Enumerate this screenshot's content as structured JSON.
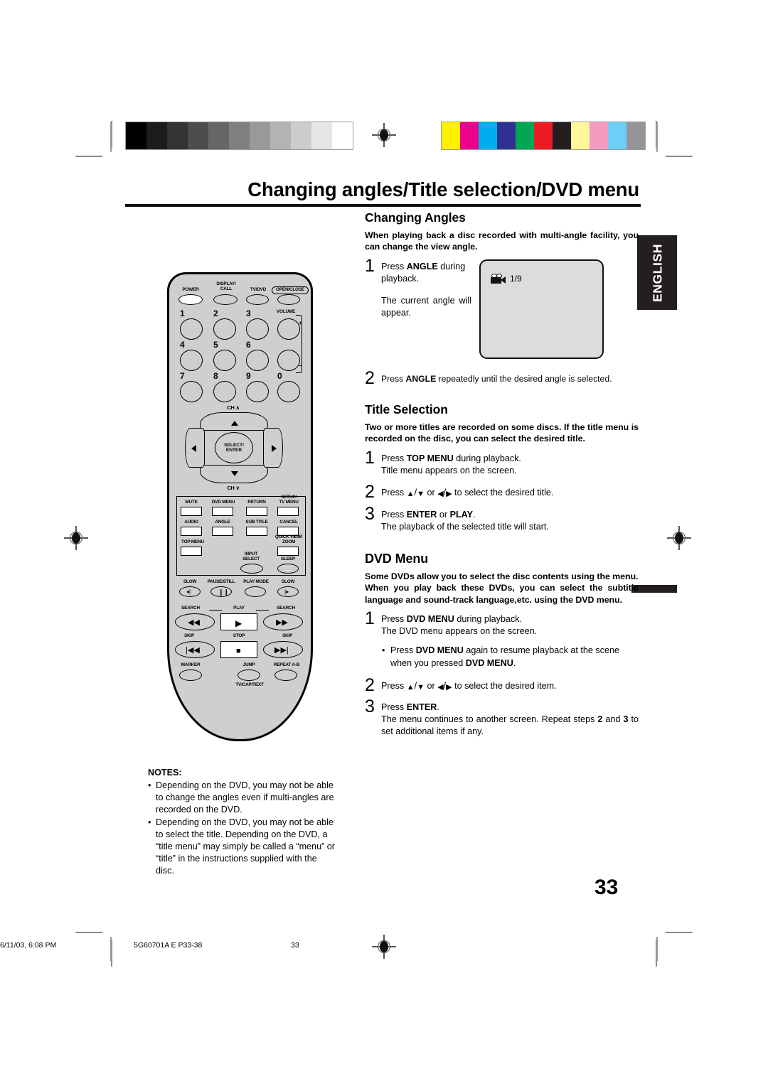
{
  "header": {
    "title": "Changing angles/Title selection/DVD menu",
    "lang_tab": "ENGLISH"
  },
  "sections": {
    "changing_angles": {
      "heading": "Changing Angles",
      "lead": "When playing back a disc recorded with multi-angle facility, you can change the view angle.",
      "step1_num": "1",
      "step1_a_pre": "Press ",
      "step1_a_key": "ANGLE",
      "step1_a_post": " during playback.",
      "step1_b": "The current angle will appear.",
      "osd_value": "1/9",
      "osd_icon": "camera-icon",
      "step2_num": "2",
      "step2_pre": "Press ",
      "step2_key": "ANGLE",
      "step2_post": " repeatedly until the desired angle is selected."
    },
    "title_selection": {
      "heading": "Title Selection",
      "lead": "Two or more titles are recorded on some discs. If the title menu is recorded on the disc, you can select the desired title.",
      "step1_num": "1",
      "step1_pre": "Press ",
      "step1_key": "TOP MENU",
      "step1_post": " during playback.",
      "step1_sub": "Title menu appears on the screen.",
      "step2_num": "2",
      "step2_pre": "Press ",
      "step2_mid": " or ",
      "step2_post": " to select the desired title.",
      "step3_num": "3",
      "step3_pre": "Press ",
      "step3_key1": "ENTER",
      "step3_mid": " or ",
      "step3_key2": "PLAY",
      "step3_post": ".",
      "step3_sub": "The playback of the selected title will start."
    },
    "dvd_menu": {
      "heading": "DVD Menu",
      "lead1": "Some DVDs allow you to select the disc contents using the menu.",
      "lead2": "When you play back these DVDs, you can select the subtitle language and sound-track language,etc. using the DVD menu.",
      "step1_num": "1",
      "step1_pre": "Press ",
      "step1_key": "DVD MENU",
      "step1_post": " during playback.",
      "step1_sub": "The DVD menu appears on the screen.",
      "bullet_dot": "•",
      "bullet_pre": "Press ",
      "bullet_key1": "DVD MENU",
      "bullet_mid": " again to resume playback at the scene when you pressed ",
      "bullet_key2": "DVD MENU",
      "bullet_post": ".",
      "step2_num": "2",
      "step2_pre": "Press ",
      "step2_mid": " or ",
      "step2_post": " to select the desired item.",
      "step3_num": "3",
      "step3_pre": "Press ",
      "step3_key": "ENTER",
      "step3_post": ".",
      "step3_sub_a": "The menu continues to another screen. Repeat steps ",
      "step3_sub_b": "2",
      "step3_sub_c": " and ",
      "step3_sub_d": "3",
      "step3_sub_e": " to set additional items if any."
    }
  },
  "arrows": {
    "up": "▲",
    "down": "▼",
    "left": "◀",
    "right": "▶",
    "slash": "/"
  },
  "notes": {
    "heading": "NOTES:",
    "bullet": "•",
    "items": [
      "Depending on the DVD, you may not be able to change the angles even if multi-angles are recorded on the DVD.",
      "Depending on the DVD, you may not be able to select the title. Depending on the DVD, a “title menu” may simply be called a “menu” or “title” in the instructions supplied with the disc."
    ]
  },
  "page_number": "33",
  "footer": {
    "doc_code": "5G60701A E P33-38",
    "page": "33",
    "timestamp": "6/11/03, 6:08 PM"
  },
  "print_marks": {
    "grayscale": [
      "#000000",
      "#1c1c1c",
      "#333333",
      "#4d4d4d",
      "#666666",
      "#808080",
      "#999999",
      "#b3b3b3",
      "#cccccc",
      "#e6e6e6",
      "#ffffff"
    ],
    "colors": [
      "#fff100",
      "#ec008c",
      "#00aeef",
      "#2e3192",
      "#00a651",
      "#ed1c24",
      "#231f20",
      "#fff79a",
      "#f49ac1",
      "#6dcff6",
      "#939598"
    ]
  },
  "remote": {
    "top_buttons": [
      {
        "label": "POWER",
        "name": "power-button"
      },
      {
        "label": "DISPLAY/\nCALL",
        "name": "display-call-button"
      },
      {
        "label": "TV/DVD",
        "name": "tv-dvd-button"
      },
      {
        "label": "OPEN/CLOSE",
        "name": "open-close-button"
      }
    ],
    "keypad": [
      "1",
      "2",
      "3",
      "4",
      "5",
      "6",
      "7",
      "8",
      "9",
      "0"
    ],
    "volume_label": "VOLUME",
    "volume_plus": "+",
    "volume_minus": "–",
    "dpad": {
      "ch_up": "CH",
      "ch_up_arrow": "∧",
      "ch_down": "CH",
      "ch_down_arrow": "∨",
      "center_line1": "SELECT/",
      "center_line2": "ENTER"
    },
    "function_buttons": [
      {
        "label": "MUTE",
        "name": "mute-button"
      },
      {
        "label": "DVD MENU",
        "name": "dvd-menu-button"
      },
      {
        "label": "RETURN",
        "name": "return-button"
      },
      {
        "label": "SETUP/\nTV MENU",
        "name": "setup-tv-menu-button"
      },
      {
        "label": "AUDIO",
        "name": "audio-button"
      },
      {
        "label": "ANGLE",
        "name": "angle-button"
      },
      {
        "label": "SUB TITLE",
        "name": "sub-title-button"
      },
      {
        "label": "CANCEL",
        "name": "cancel-button"
      },
      {
        "label": "TOP MENU",
        "name": "top-menu-button"
      },
      {
        "label": "QUICK VIEW/\nZOOM",
        "name": "quick-view-zoom-button"
      },
      {
        "label": "INPUT\nSELECT",
        "name": "input-select-button"
      },
      {
        "label": "SLEEP",
        "name": "sleep-button"
      }
    ],
    "transport_row1": [
      {
        "label": "SLOW",
        "name": "slow-reverse-button"
      },
      {
        "label": "PAUSE/STILL",
        "name": "pause-still-button"
      },
      {
        "label": "PLAY MODE",
        "name": "play-mode-button"
      },
      {
        "label": "SLOW",
        "name": "slow-forward-button"
      }
    ],
    "transport_row2": [
      {
        "label": "SEARCH",
        "name": "search-reverse-button"
      },
      {
        "label": "PLAY",
        "name": "play-button"
      },
      {
        "label": "SEARCH",
        "name": "search-forward-button"
      }
    ],
    "transport_row3": [
      {
        "label": "SKIP",
        "name": "skip-back-button"
      },
      {
        "label": "STOP",
        "name": "stop-button"
      },
      {
        "label": "SKIP",
        "name": "skip-forward-button"
      }
    ],
    "transport_row4": [
      {
        "label": "MARKER",
        "name": "marker-button"
      },
      {
        "label": "JUMP",
        "name": "jump-button"
      },
      {
        "label": "REPEAT A-B",
        "name": "repeat-ab-button"
      }
    ],
    "tv_cap_text": "TV/CAP/TEXT"
  }
}
